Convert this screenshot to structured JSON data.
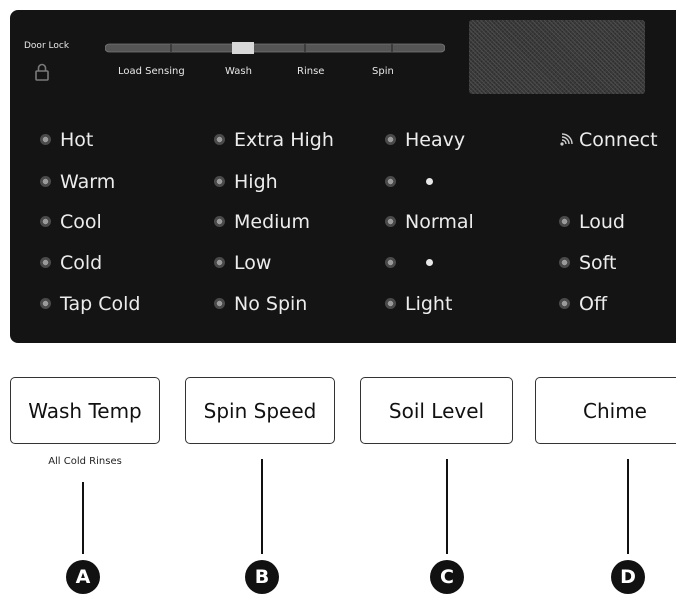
{
  "door_lock_label": "Door Lock",
  "status_stages": [
    "Load Sensing",
    "Wash",
    "Rinse",
    "Spin"
  ],
  "columns": {
    "wash_temp": [
      "Hot",
      "Warm",
      "Cool",
      "Cold",
      "Tap Cold"
    ],
    "spin_speed": [
      "Extra High",
      "High",
      "Medium",
      "Low",
      "No Spin"
    ],
    "soil_level": [
      "Heavy",
      "Normal",
      "Light"
    ],
    "chime": [
      "Connect",
      "Loud",
      "Soft",
      "Off"
    ]
  },
  "buttons": {
    "wash_temp": "Wash Temp",
    "spin_speed": "Spin Speed",
    "soil_level": "Soil Level",
    "chime": "Chime"
  },
  "wash_temp_sublabel": "All Cold Rinses",
  "callouts": [
    "A",
    "B",
    "C",
    "D"
  ],
  "colors": {
    "panel": "#141414",
    "text": "#ececec",
    "callout": "#111111"
  }
}
